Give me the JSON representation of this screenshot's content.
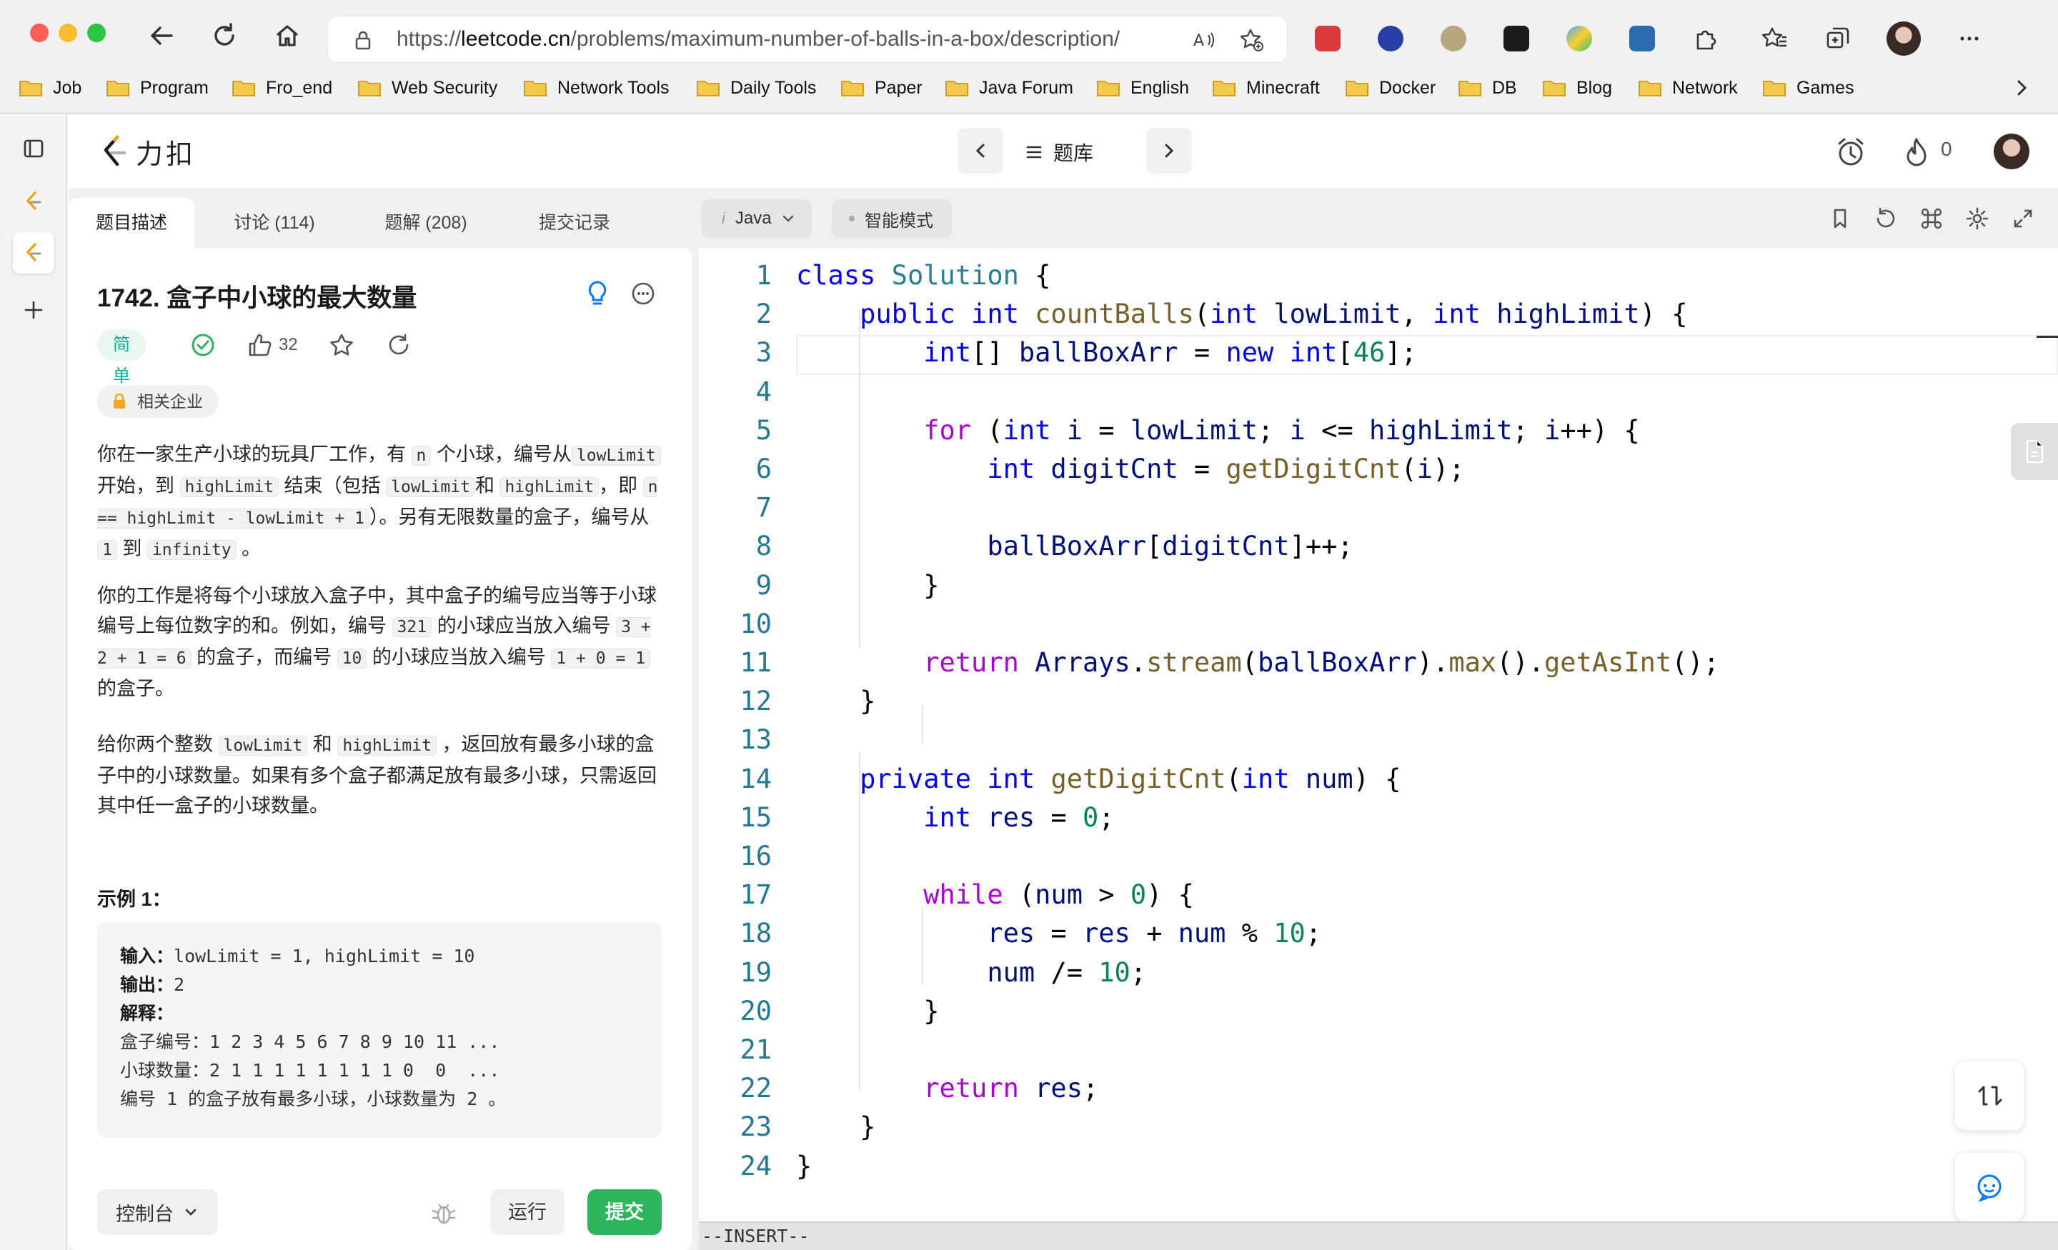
{
  "browser": {
    "url_prefix": "https://",
    "url_domain": "leetcode.cn",
    "url_path": "/problems/maximum-number-of-balls-in-a-box/description/",
    "bookmarks": [
      "Job",
      "Program",
      "Fro_end",
      "Web Security",
      "Network Tools",
      "Daily Tools",
      "Paper",
      "Java Forum",
      "English",
      "Minecraft",
      "Docker",
      "DB",
      "Blog",
      "Network",
      "Games"
    ]
  },
  "header": {
    "logo_text": "力扣",
    "problem_list_label": "题库",
    "streak_count": "0"
  },
  "tabs": [
    "题目描述",
    "讨论 (114)",
    "题解 (208)",
    "提交记录"
  ],
  "problem": {
    "title": "1742. 盒子中小球的最大数量",
    "difficulty": "简单",
    "likes": "32",
    "company_tag": "相关企业",
    "p1": {
      "t1": "你在一家生产小球的玩具厂工作，有 ",
      "c1": "n",
      "t2": " 个小球，编号从",
      "c2": "lowLimit",
      "t3": " 开始，到 ",
      "c3": "highLimit",
      "t4": " 结束（包括 ",
      "c4": "lowLimit",
      "t5": "和 ",
      "c5": "highLimit",
      "t6": "，即 ",
      "c6": "n == highLimit - lowLimit + 1",
      "t7": "）。另有无限数量的盒子，编号从 ",
      "c7": "1",
      "t8": " 到 ",
      "c8": "infinity",
      "t9": " 。"
    },
    "p2": {
      "t1": "你的工作是将每个小球放入盒子中，其中盒子的编号应当等于小球编号上每位数字的和。例如，编号 ",
      "c1": "321",
      "t2": " 的小球应当放入编号 ",
      "c2": "3 + 2 + 1 = 6",
      "t3": " 的盒子，而编号 ",
      "c3": "10",
      "t4": " 的小球应当放入编号 ",
      "c4": "1 + 0 = 1",
      "t5": " 的盒子。"
    },
    "p3": {
      "t1": "给你两个整数 ",
      "c1": "lowLimit",
      "t2": " 和 ",
      "c2": "highLimit",
      "t3": " ，返回放有最多小球的盒子中的小球数量。如果有多个盒子都满足放有最多小球，只需返回其中任一盒子的小球数量。"
    },
    "example_title": "示例 1：",
    "example": {
      "input_label": "输入：",
      "input_value": "lowLimit = 1, highLimit = 10",
      "output_label": "输出：",
      "output_value": "2",
      "explain_label": "解释：",
      "row1": "盒子编号：1 2 3 4 5 6 7 8 9 10 11 ...",
      "row2": "小球数量：2 1 1 1 1 1 1 1 1 0  0  ...",
      "row3": "编号 1 的盒子放有最多小球，小球数量为 2 。"
    }
  },
  "actions": {
    "console": "控制台",
    "run": "运行",
    "submit": "提交"
  },
  "editor": {
    "language": "Java",
    "mode_label": "智能模式",
    "status": "--INSERT--",
    "lines": [
      [
        [
          "kw",
          "class"
        ],
        [
          "t",
          " "
        ],
        [
          "ty",
          "Solution"
        ],
        [
          "t",
          " {"
        ]
      ],
      [
        [
          "t",
          "    "
        ],
        [
          "kw",
          "public"
        ],
        [
          "t",
          " "
        ],
        [
          "kw",
          "int"
        ],
        [
          "t",
          " "
        ],
        [
          "fn",
          "countBalls"
        ],
        [
          "t",
          "("
        ],
        [
          "kw",
          "int"
        ],
        [
          "t",
          " "
        ],
        [
          "var",
          "lowLimit"
        ],
        [
          "t",
          ", "
        ],
        [
          "kw",
          "int"
        ],
        [
          "t",
          " "
        ],
        [
          "var",
          "highLimit"
        ],
        [
          "t",
          ") {"
        ]
      ],
      [
        [
          "t",
          "        "
        ],
        [
          "kw",
          "int"
        ],
        [
          "t",
          "[] "
        ],
        [
          "var",
          "ballBoxArr"
        ],
        [
          "t",
          " = "
        ],
        [
          "kw",
          "new"
        ],
        [
          "t",
          " "
        ],
        [
          "kw",
          "int"
        ],
        [
          "t",
          "["
        ],
        [
          "nm",
          "46"
        ],
        [
          "t",
          "];"
        ]
      ],
      [
        [
          "t",
          ""
        ]
      ],
      [
        [
          "t",
          "        "
        ],
        [
          "ret",
          "for"
        ],
        [
          "t",
          " ("
        ],
        [
          "kw",
          "int"
        ],
        [
          "t",
          " "
        ],
        [
          "var",
          "i"
        ],
        [
          "t",
          " = "
        ],
        [
          "var",
          "lowLimit"
        ],
        [
          "t",
          "; "
        ],
        [
          "var",
          "i"
        ],
        [
          "t",
          " <= "
        ],
        [
          "var",
          "highLimit"
        ],
        [
          "t",
          "; "
        ],
        [
          "var",
          "i"
        ],
        [
          "t",
          "++) {"
        ]
      ],
      [
        [
          "t",
          "            "
        ],
        [
          "kw",
          "int"
        ],
        [
          "t",
          " "
        ],
        [
          "var",
          "digitCnt"
        ],
        [
          "t",
          " = "
        ],
        [
          "fn",
          "getDigitCnt"
        ],
        [
          "t",
          "("
        ],
        [
          "var",
          "i"
        ],
        [
          "t",
          ");"
        ]
      ],
      [
        [
          "t",
          ""
        ]
      ],
      [
        [
          "t",
          "            "
        ],
        [
          "var",
          "ballBoxArr"
        ],
        [
          "t",
          "["
        ],
        [
          "var",
          "digitCnt"
        ],
        [
          "t",
          "]++;"
        ]
      ],
      [
        [
          "t",
          "        }"
        ]
      ],
      [
        [
          "t",
          ""
        ]
      ],
      [
        [
          "t",
          "        "
        ],
        [
          "ret",
          "return"
        ],
        [
          "t",
          " "
        ],
        [
          "var",
          "Arrays"
        ],
        [
          "t",
          "."
        ],
        [
          "fn",
          "stream"
        ],
        [
          "t",
          "("
        ],
        [
          "var",
          "ballBoxArr"
        ],
        [
          "t",
          ")."
        ],
        [
          "fn",
          "max"
        ],
        [
          "t",
          "()."
        ],
        [
          "fn",
          "getAsInt"
        ],
        [
          "t",
          "();"
        ]
      ],
      [
        [
          "t",
          "    }"
        ]
      ],
      [
        [
          "t",
          ""
        ]
      ],
      [
        [
          "t",
          "    "
        ],
        [
          "kw",
          "private"
        ],
        [
          "t",
          " "
        ],
        [
          "kw",
          "int"
        ],
        [
          "t",
          " "
        ],
        [
          "fn",
          "getDigitCnt"
        ],
        [
          "t",
          "("
        ],
        [
          "kw",
          "int"
        ],
        [
          "t",
          " "
        ],
        [
          "var",
          "num"
        ],
        [
          "t",
          ") {"
        ]
      ],
      [
        [
          "t",
          "        "
        ],
        [
          "kw",
          "int"
        ],
        [
          "t",
          " "
        ],
        [
          "var",
          "res"
        ],
        [
          "t",
          " = "
        ],
        [
          "nm",
          "0"
        ],
        [
          "t",
          ";"
        ]
      ],
      [
        [
          "t",
          ""
        ]
      ],
      [
        [
          "t",
          "        "
        ],
        [
          "ret",
          "while"
        ],
        [
          "t",
          " ("
        ],
        [
          "var",
          "num"
        ],
        [
          "t",
          " > "
        ],
        [
          "nm",
          "0"
        ],
        [
          "t",
          ") {"
        ]
      ],
      [
        [
          "t",
          "            "
        ],
        [
          "var",
          "res"
        ],
        [
          "t",
          " = "
        ],
        [
          "var",
          "res"
        ],
        [
          "t",
          " + "
        ],
        [
          "var",
          "num"
        ],
        [
          "t",
          " % "
        ],
        [
          "nm",
          "10"
        ],
        [
          "t",
          ";"
        ]
      ],
      [
        [
          "t",
          "            "
        ],
        [
          "var",
          "num"
        ],
        [
          "t",
          " /= "
        ],
        [
          "nm",
          "10"
        ],
        [
          "t",
          ";"
        ]
      ],
      [
        [
          "t",
          "        }"
        ]
      ],
      [
        [
          "t",
          ""
        ]
      ],
      [
        [
          "t",
          "        "
        ],
        [
          "ret",
          "return"
        ],
        [
          "t",
          " "
        ],
        [
          "var",
          "res"
        ],
        [
          "t",
          ";"
        ]
      ],
      [
        [
          "t",
          "    }"
        ]
      ],
      [
        [
          "t",
          "}"
        ]
      ]
    ]
  }
}
